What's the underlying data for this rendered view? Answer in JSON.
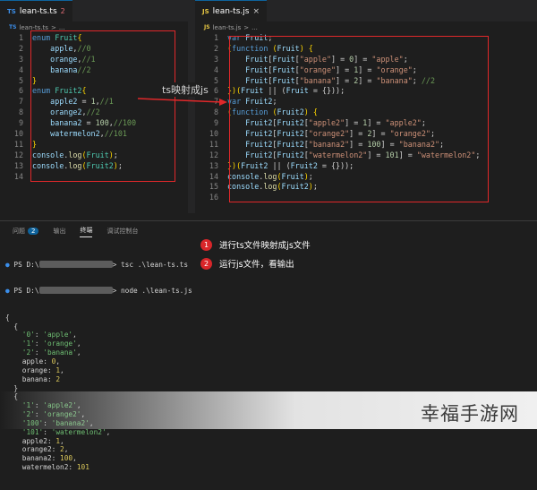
{
  "left_editor": {
    "tab_icon": "TS",
    "tab_label": "lean-ts.ts",
    "tab_count": "2",
    "breadcrumb_icon": "TS",
    "breadcrumb": "lean-ts.ts",
    "breadcrumb_sep": ">",
    "breadcrumb_tail": "...",
    "lines": [
      {
        "n": "1",
        "t": [
          {
            "c": "kw",
            "v": "enum "
          },
          {
            "c": "id",
            "v": "Fruit"
          },
          {
            "c": "br",
            "v": "{"
          }
        ]
      },
      {
        "n": "2",
        "t": [
          {
            "c": "var",
            "v": "    apple"
          },
          {
            "c": "pl",
            "v": ","
          },
          {
            "c": "cm",
            "v": "//0"
          }
        ]
      },
      {
        "n": "3",
        "t": [
          {
            "c": "var",
            "v": "    orange"
          },
          {
            "c": "pl",
            "v": ","
          },
          {
            "c": "cm",
            "v": "//1"
          }
        ]
      },
      {
        "n": "4",
        "t": [
          {
            "c": "var",
            "v": "    banana"
          },
          {
            "c": "cm",
            "v": "//2"
          }
        ]
      },
      {
        "n": "5",
        "t": [
          {
            "c": "br",
            "v": "}"
          }
        ]
      },
      {
        "n": "6",
        "t": [
          {
            "c": "kw",
            "v": "enum "
          },
          {
            "c": "id",
            "v": "Fruit2"
          },
          {
            "c": "br",
            "v": "{"
          }
        ]
      },
      {
        "n": "7",
        "t": [
          {
            "c": "var",
            "v": "    apple2"
          },
          {
            "c": "pl",
            "v": " = "
          },
          {
            "c": "num",
            "v": "1"
          },
          {
            "c": "pl",
            "v": ","
          },
          {
            "c": "cm",
            "v": "//1"
          }
        ]
      },
      {
        "n": "8",
        "t": [
          {
            "c": "var",
            "v": "    orange2"
          },
          {
            "c": "pl",
            "v": ","
          },
          {
            "c": "cm",
            "v": "//2"
          }
        ]
      },
      {
        "n": "9",
        "t": [
          {
            "c": "var",
            "v": "    banana2"
          },
          {
            "c": "pl",
            "v": " = "
          },
          {
            "c": "num",
            "v": "100"
          },
          {
            "c": "pl",
            "v": ","
          },
          {
            "c": "cm",
            "v": "//100"
          }
        ]
      },
      {
        "n": "10",
        "t": [
          {
            "c": "var",
            "v": "    watermelon2"
          },
          {
            "c": "pl",
            "v": ","
          },
          {
            "c": "cm",
            "v": "//101"
          }
        ]
      },
      {
        "n": "11",
        "t": [
          {
            "c": "br",
            "v": "}"
          }
        ]
      },
      {
        "n": "12",
        "t": [
          {
            "c": "var",
            "v": "console"
          },
          {
            "c": "pl",
            "v": "."
          },
          {
            "c": "fn",
            "v": "log"
          },
          {
            "c": "br",
            "v": "("
          },
          {
            "c": "id",
            "v": "Fruit"
          },
          {
            "c": "br",
            "v": ")"
          },
          {
            "c": "pl",
            "v": ";"
          }
        ]
      },
      {
        "n": "13",
        "t": [
          {
            "c": "var",
            "v": "console"
          },
          {
            "c": "pl",
            "v": "."
          },
          {
            "c": "fn",
            "v": "log"
          },
          {
            "c": "br",
            "v": "("
          },
          {
            "c": "id",
            "v": "Fruit2"
          },
          {
            "c": "br",
            "v": ")"
          },
          {
            "c": "pl",
            "v": ";"
          }
        ]
      },
      {
        "n": "14",
        "t": []
      }
    ]
  },
  "right_editor": {
    "tab_icon": "JS",
    "tab_label": "lean-ts.js",
    "tab_close": "×",
    "breadcrumb_icon": "JS",
    "breadcrumb": "lean-ts.js",
    "breadcrumb_sep": ">",
    "breadcrumb_tail": "...",
    "lines": [
      {
        "n": "1",
        "t": [
          {
            "c": "kw",
            "v": "var "
          },
          {
            "c": "var",
            "v": "Fruit"
          },
          {
            "c": "pl",
            "v": ";"
          }
        ]
      },
      {
        "n": "2",
        "t": [
          {
            "c": "br",
            "v": "("
          },
          {
            "c": "kw",
            "v": "function "
          },
          {
            "c": "br",
            "v": "("
          },
          {
            "c": "var",
            "v": "Fruit"
          },
          {
            "c": "br",
            "v": ") {"
          }
        ]
      },
      {
        "n": "3",
        "t": [
          {
            "c": "var",
            "v": "    Fruit"
          },
          {
            "c": "pl",
            "v": "["
          },
          {
            "c": "var",
            "v": "Fruit"
          },
          {
            "c": "pl",
            "v": "["
          },
          {
            "c": "str",
            "v": "\"apple\""
          },
          {
            "c": "pl",
            "v": "] = "
          },
          {
            "c": "num",
            "v": "0"
          },
          {
            "c": "pl",
            "v": "] = "
          },
          {
            "c": "str",
            "v": "\"apple\""
          },
          {
            "c": "pl",
            "v": ";"
          }
        ]
      },
      {
        "n": "4",
        "t": [
          {
            "c": "var",
            "v": "    Fruit"
          },
          {
            "c": "pl",
            "v": "["
          },
          {
            "c": "var",
            "v": "Fruit"
          },
          {
            "c": "pl",
            "v": "["
          },
          {
            "c": "str",
            "v": "\"orange\""
          },
          {
            "c": "pl",
            "v": "] = "
          },
          {
            "c": "num",
            "v": "1"
          },
          {
            "c": "pl",
            "v": "] = "
          },
          {
            "c": "str",
            "v": "\"orange\""
          },
          {
            "c": "pl",
            "v": ";"
          }
        ]
      },
      {
        "n": "5",
        "t": [
          {
            "c": "var",
            "v": "    Fruit"
          },
          {
            "c": "pl",
            "v": "["
          },
          {
            "c": "var",
            "v": "Fruit"
          },
          {
            "c": "pl",
            "v": "["
          },
          {
            "c": "str",
            "v": "\"banana\""
          },
          {
            "c": "pl",
            "v": "] = "
          },
          {
            "c": "num",
            "v": "2"
          },
          {
            "c": "pl",
            "v": "] = "
          },
          {
            "c": "str",
            "v": "\"banana\""
          },
          {
            "c": "pl",
            "v": "; "
          },
          {
            "c": "cm",
            "v": "//2"
          }
        ]
      },
      {
        "n": "6",
        "t": [
          {
            "c": "br",
            "v": "})("
          },
          {
            "c": "var",
            "v": "Fruit"
          },
          {
            "c": "pl",
            "v": " || ("
          },
          {
            "c": "var",
            "v": "Fruit"
          },
          {
            "c": "pl",
            "v": " = {}));"
          }
        ]
      },
      {
        "n": "7",
        "t": [
          {
            "c": "kw",
            "v": "var "
          },
          {
            "c": "var",
            "v": "Fruit2"
          },
          {
            "c": "pl",
            "v": ";"
          }
        ]
      },
      {
        "n": "8",
        "t": [
          {
            "c": "br",
            "v": "("
          },
          {
            "c": "kw",
            "v": "function "
          },
          {
            "c": "br",
            "v": "("
          },
          {
            "c": "var",
            "v": "Fruit2"
          },
          {
            "c": "br",
            "v": ") {"
          }
        ]
      },
      {
        "n": "9",
        "t": [
          {
            "c": "var",
            "v": "    Fruit2"
          },
          {
            "c": "pl",
            "v": "["
          },
          {
            "c": "var",
            "v": "Fruit2"
          },
          {
            "c": "pl",
            "v": "["
          },
          {
            "c": "str",
            "v": "\"apple2\""
          },
          {
            "c": "pl",
            "v": "] = "
          },
          {
            "c": "num",
            "v": "1"
          },
          {
            "c": "pl",
            "v": "] = "
          },
          {
            "c": "str",
            "v": "\"apple2\""
          },
          {
            "c": "pl",
            "v": ";"
          }
        ]
      },
      {
        "n": "10",
        "t": [
          {
            "c": "var",
            "v": "    Fruit2"
          },
          {
            "c": "pl",
            "v": "["
          },
          {
            "c": "var",
            "v": "Fruit2"
          },
          {
            "c": "pl",
            "v": "["
          },
          {
            "c": "str",
            "v": "\"orange2\""
          },
          {
            "c": "pl",
            "v": "] = "
          },
          {
            "c": "num",
            "v": "2"
          },
          {
            "c": "pl",
            "v": "] = "
          },
          {
            "c": "str",
            "v": "\"orange2\""
          },
          {
            "c": "pl",
            "v": ";"
          }
        ]
      },
      {
        "n": "11",
        "t": [
          {
            "c": "var",
            "v": "    Fruit2"
          },
          {
            "c": "pl",
            "v": "["
          },
          {
            "c": "var",
            "v": "Fruit2"
          },
          {
            "c": "pl",
            "v": "["
          },
          {
            "c": "str",
            "v": "\"banana2\""
          },
          {
            "c": "pl",
            "v": "] = "
          },
          {
            "c": "num",
            "v": "100"
          },
          {
            "c": "pl",
            "v": "] = "
          },
          {
            "c": "str",
            "v": "\"banana2\""
          },
          {
            "c": "pl",
            "v": ";"
          }
        ]
      },
      {
        "n": "12",
        "t": [
          {
            "c": "var",
            "v": "    Fruit2"
          },
          {
            "c": "pl",
            "v": "["
          },
          {
            "c": "var",
            "v": "Fruit2"
          },
          {
            "c": "pl",
            "v": "["
          },
          {
            "c": "str",
            "v": "\"watermelon2\""
          },
          {
            "c": "pl",
            "v": "] = "
          },
          {
            "c": "num",
            "v": "101"
          },
          {
            "c": "pl",
            "v": "] = "
          },
          {
            "c": "str",
            "v": "\"watermelon2\""
          },
          {
            "c": "pl",
            "v": ";"
          }
        ]
      },
      {
        "n": "13",
        "t": [
          {
            "c": "br",
            "v": "})("
          },
          {
            "c": "var",
            "v": "Fruit2"
          },
          {
            "c": "pl",
            "v": " || ("
          },
          {
            "c": "var",
            "v": "Fruit2"
          },
          {
            "c": "pl",
            "v": " = {}));"
          }
        ]
      },
      {
        "n": "14",
        "t": [
          {
            "c": "var",
            "v": "console"
          },
          {
            "c": "pl",
            "v": "."
          },
          {
            "c": "fn",
            "v": "log"
          },
          {
            "c": "br",
            "v": "("
          },
          {
            "c": "var",
            "v": "Fruit"
          },
          {
            "c": "br",
            "v": ")"
          },
          {
            "c": "pl",
            "v": ";"
          }
        ]
      },
      {
        "n": "15",
        "t": [
          {
            "c": "var",
            "v": "console"
          },
          {
            "c": "pl",
            "v": "."
          },
          {
            "c": "fn",
            "v": "log"
          },
          {
            "c": "br",
            "v": "("
          },
          {
            "c": "var",
            "v": "Fruit2"
          },
          {
            "c": "br",
            "v": ")"
          },
          {
            "c": "pl",
            "v": ";"
          }
        ]
      },
      {
        "n": "16",
        "t": []
      }
    ]
  },
  "annotation_arrow_label": "ts映射成js",
  "panel": {
    "tabs": [
      "问题",
      "输出",
      "终端",
      "调试控制台"
    ],
    "problems_badge": "2",
    "active_tab": "终端"
  },
  "terminal": {
    "cmd1_prefix": "PS D:\\",
    "cmd1": "> tsc .\\lean-ts.ts",
    "cmd2_prefix": "PS D:\\",
    "cmd2": "> node .\\lean-ts.js",
    "output": [
      [
        {
          "c": "pl",
          "v": "{"
        }
      ],
      [
        {
          "c": "pl",
          "v": "  {"
        }
      ],
      [
        {
          "c": "t-str",
          "v": "    '0'"
        },
        {
          "c": "pl",
          "v": ": "
        },
        {
          "c": "t-str",
          "v": "'apple'"
        },
        {
          "c": "pl",
          "v": ","
        }
      ],
      [
        {
          "c": "t-str",
          "v": "    '1'"
        },
        {
          "c": "pl",
          "v": ": "
        },
        {
          "c": "t-str",
          "v": "'orange'"
        },
        {
          "c": "pl",
          "v": ","
        }
      ],
      [
        {
          "c": "t-str",
          "v": "    '2'"
        },
        {
          "c": "pl",
          "v": ": "
        },
        {
          "c": "t-str",
          "v": "'banana'"
        },
        {
          "c": "pl",
          "v": ","
        }
      ],
      [
        {
          "c": "pl",
          "v": "    apple: "
        },
        {
          "c": "t-num",
          "v": "0"
        },
        {
          "c": "pl",
          "v": ","
        }
      ],
      [
        {
          "c": "pl",
          "v": "    orange: "
        },
        {
          "c": "t-num",
          "v": "1"
        },
        {
          "c": "pl",
          "v": ","
        }
      ],
      [
        {
          "c": "pl",
          "v": "    banana: "
        },
        {
          "c": "t-num",
          "v": "2"
        }
      ],
      [
        {
          "c": "pl",
          "v": "  }"
        }
      ],
      [
        {
          "c": "pl",
          "v": "  {"
        }
      ],
      [
        {
          "c": "t-str",
          "v": "    '1'"
        },
        {
          "c": "pl",
          "v": ": "
        },
        {
          "c": "t-str",
          "v": "'apple2'"
        },
        {
          "c": "pl",
          "v": ","
        }
      ],
      [
        {
          "c": "t-str",
          "v": "    '2'"
        },
        {
          "c": "pl",
          "v": ": "
        },
        {
          "c": "t-str",
          "v": "'orange2'"
        },
        {
          "c": "pl",
          "v": ","
        }
      ],
      [
        {
          "c": "t-str",
          "v": "    '100'"
        },
        {
          "c": "pl",
          "v": ": "
        },
        {
          "c": "t-str",
          "v": "'banana2'"
        },
        {
          "c": "pl",
          "v": ","
        }
      ],
      [
        {
          "c": "t-str",
          "v": "    '101'"
        },
        {
          "c": "pl",
          "v": ": "
        },
        {
          "c": "t-str",
          "v": "'watermelon2'"
        },
        {
          "c": "pl",
          "v": ","
        }
      ],
      [
        {
          "c": "pl",
          "v": "    apple2: "
        },
        {
          "c": "t-num",
          "v": "1"
        },
        {
          "c": "pl",
          "v": ","
        }
      ],
      [
        {
          "c": "pl",
          "v": "    orange2: "
        },
        {
          "c": "t-num",
          "v": "2"
        },
        {
          "c": "pl",
          "v": ","
        }
      ],
      [
        {
          "c": "pl",
          "v": "    banana2: "
        },
        {
          "c": "t-num",
          "v": "100"
        },
        {
          "c": "pl",
          "v": ","
        }
      ],
      [
        {
          "c": "pl",
          "v": "    watermelon2: "
        },
        {
          "c": "t-num",
          "v": "101"
        }
      ]
    ]
  },
  "notes": [
    {
      "num": "1",
      "text": "进行ts文件映射成js文件"
    },
    {
      "num": "2",
      "text": "运行js文件，看输出"
    }
  ],
  "watermark": "幸福手游网",
  "colors": {
    "annotation_red": "#e0282a",
    "note_circle": "#d9262a",
    "accent": "#0e639c"
  }
}
